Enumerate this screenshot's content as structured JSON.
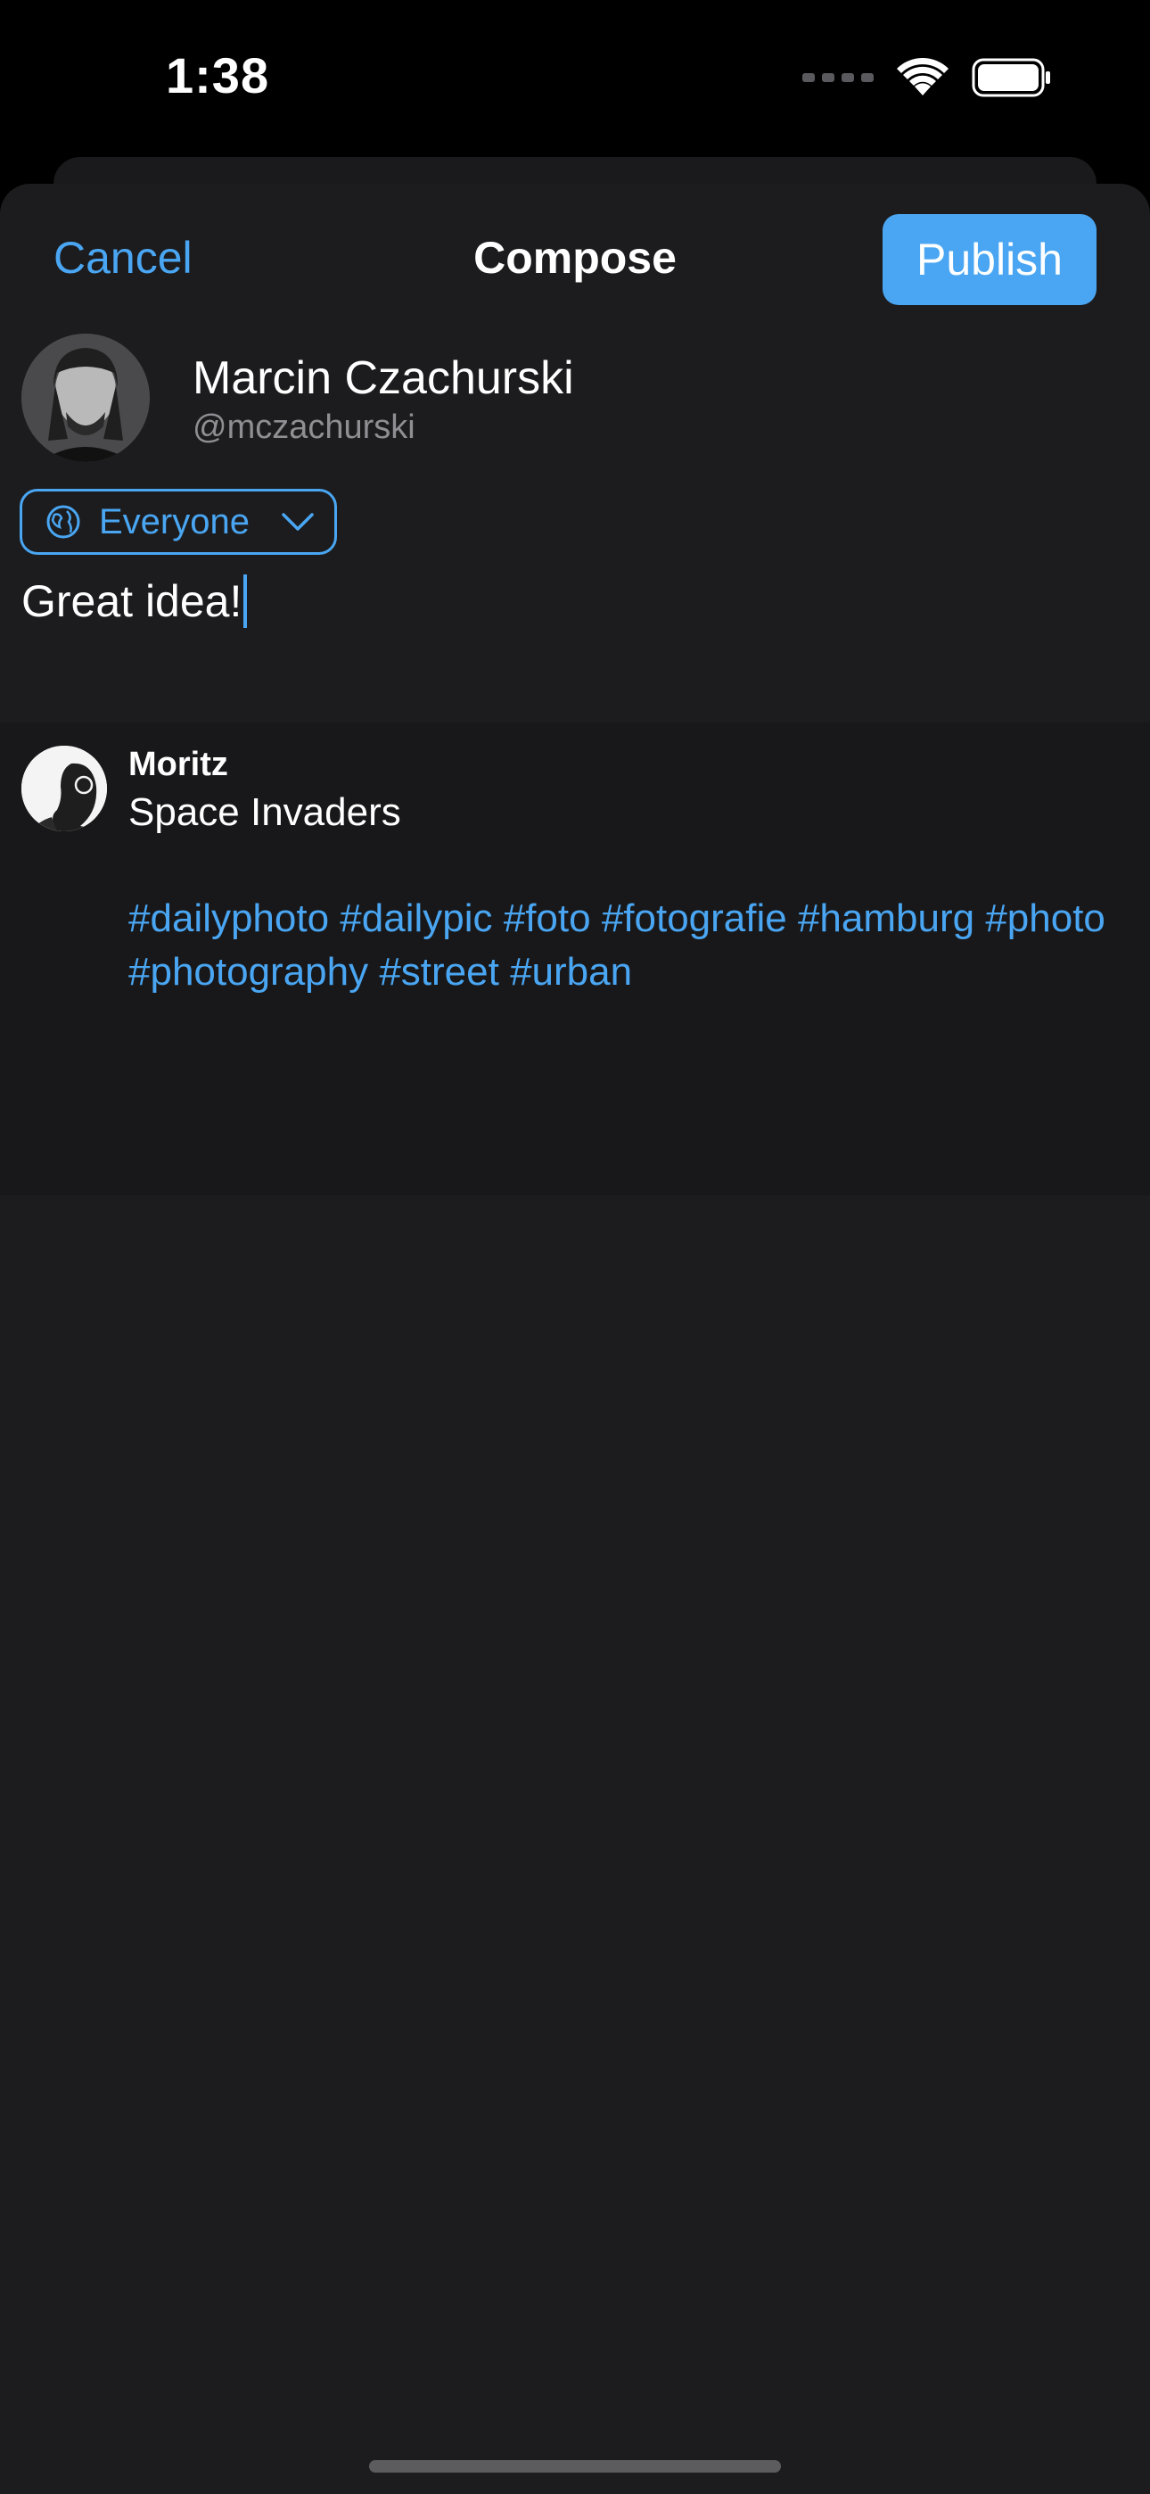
{
  "status_bar": {
    "time": "1:38",
    "icons": [
      "cellular-signal-icon",
      "wifi-icon",
      "battery-icon"
    ]
  },
  "nav": {
    "cancel_label": "Cancel",
    "title": "Compose",
    "publish_label": "Publish"
  },
  "author": {
    "name": "Marcin Czachurski",
    "handle": "@mczachurski"
  },
  "visibility": {
    "label": "Everyone",
    "icon": "globe-icon"
  },
  "compose": {
    "text": "Great idea!"
  },
  "quoted_post": {
    "author": "Moritz",
    "title": "Space Invaders",
    "tags": "#dailyphoto #dailypic #foto #fotografie #hamburg #photo #photography #street #urban"
  },
  "colors": {
    "accent": "#4aa6f2",
    "sheet_background": "#1c1c1e",
    "quoted_background": "#18181a",
    "secondary_text": "#8e8e93"
  }
}
